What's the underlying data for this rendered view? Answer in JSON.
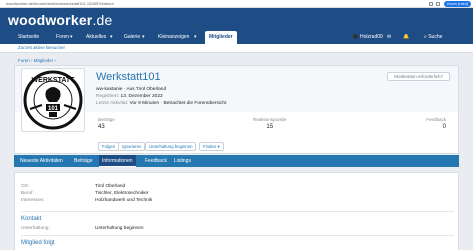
{
  "browser": {
    "url": "woodworker.de/forum/members/werkstatt101.120897/#about",
    "zoom_label": "Zoom (mini)"
  },
  "site": {
    "logo_bold": "woodworker",
    "logo_thin": ".de"
  },
  "nav": {
    "items": [
      "Startseite",
      "Foren",
      "Aktuelles",
      "Galerie",
      "Kleinanzeigen",
      "Mitglieder"
    ],
    "user": "Holzrad09",
    "search": "Suche"
  },
  "subnav": {
    "label": "Zurzeit aktive Besucher"
  },
  "breadcrumb": "Foren  ›  Mitglieder  ›",
  "profile": {
    "username": "Werkstatt101",
    "title_line": "ww-kastanie · Aus Tirol Oberland",
    "registered_label": "Registriert:",
    "registered_value": "13. Dezember 2022",
    "activity_label": "Letzte Aktivität:",
    "activity_value": "Vor 9 Minuten · Betrachtet die Forenübersicht",
    "moderation_button": "Moderation erforderlich?",
    "stats": [
      {
        "label": "Beiträge",
        "value": "43"
      },
      {
        "label": "Reaktionspunkte",
        "value": "15"
      },
      {
        "label": "Feedback",
        "value": "0"
      }
    ],
    "actions": [
      "Folgen",
      "Ignorieren",
      "Unterhaltung beginnen",
      "Finden ▾"
    ]
  },
  "tabs": [
    "Neueste Aktivitäten",
    "Beiträge",
    "Informationen",
    "Feedback",
    "Listings"
  ],
  "about": {
    "rows": [
      {
        "key": "Ort:",
        "value": "Tirol Oberland"
      },
      {
        "key": "Beruf:",
        "value": "Tischler, Elektrotechniker"
      },
      {
        "key": "Interessen:",
        "value": "Holzhandwerk und Technik"
      }
    ],
    "contact_title": "Kontakt",
    "contact_key": "Unterhaltung:",
    "contact_value": "Unterhaltung beginnen",
    "follows_title": "Mitglied folgt"
  },
  "colors": {
    "brand": "#1e4d85",
    "accent": "#2577b1"
  }
}
